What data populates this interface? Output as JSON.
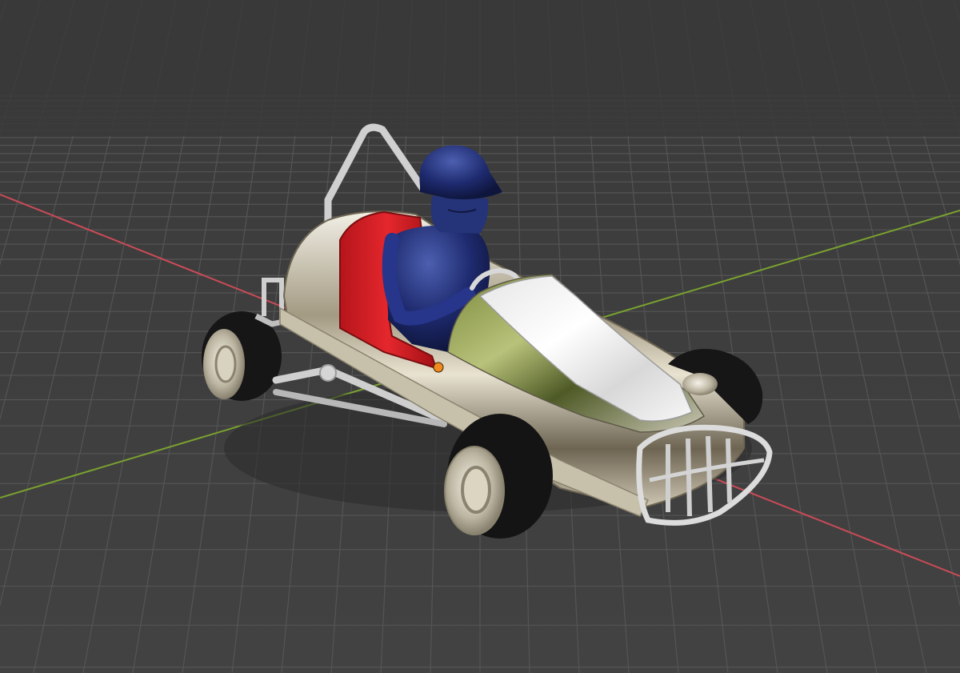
{
  "viewport": {
    "editor": "3D viewport",
    "background_color": "#3d3d3d",
    "grid_color": "#555555",
    "x_axis_color": "#c94b57",
    "y_axis_color": "#7aa22f",
    "origin_color": "#f08b1f",
    "grid": true
  },
  "scene": {
    "objects": [
      {
        "name": "go-kart",
        "material": "chrome",
        "icon": "car-icon"
      },
      {
        "name": "driver",
        "color": "#1e2a6e"
      },
      {
        "name": "seat",
        "color": "#d61f26"
      },
      {
        "name": "roll-bar",
        "color": "#c8c8c8"
      },
      {
        "name": "tires",
        "count": 4,
        "color": "#141414"
      }
    ]
  }
}
